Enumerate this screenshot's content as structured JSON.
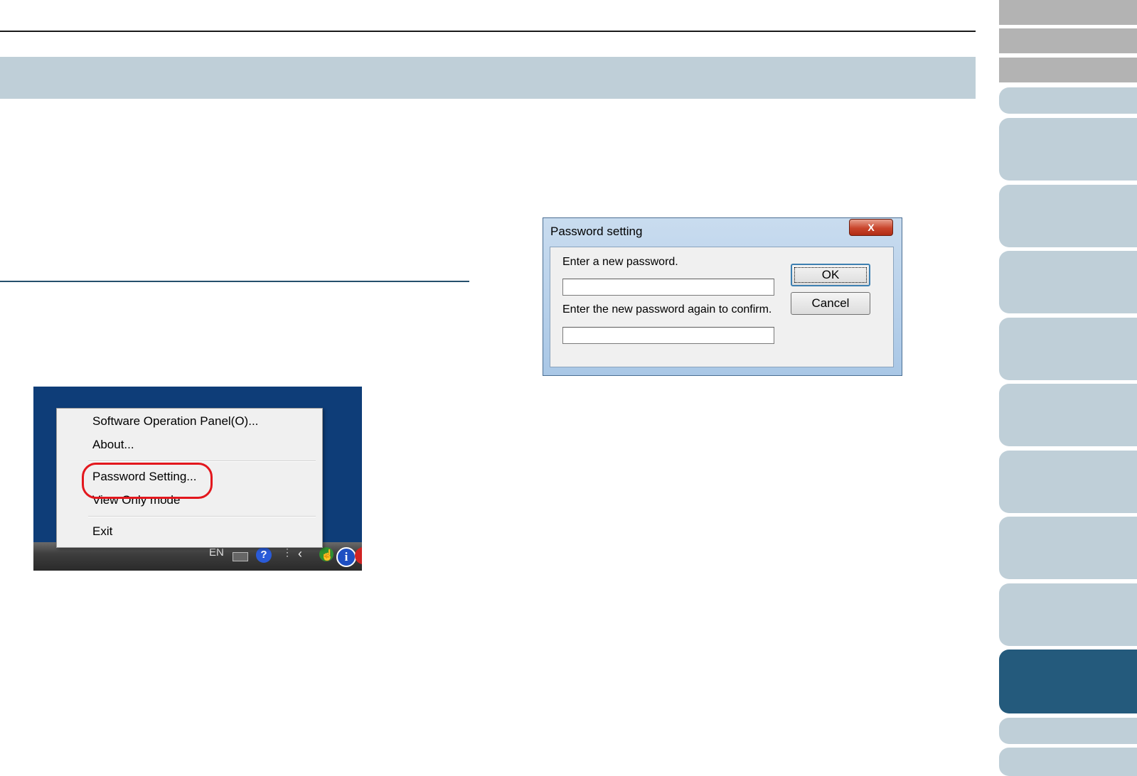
{
  "context_menu": {
    "items": [
      {
        "label": "Software Operation Panel(O)..."
      },
      {
        "label": "About..."
      },
      {
        "label": "Password Setting..."
      },
      {
        "label": "View Only mode"
      },
      {
        "label": "Exit"
      }
    ],
    "highlighted_item": "Password Setting..."
  },
  "taskbar": {
    "language": "EN",
    "help_glyph": "?",
    "info_glyph": "i",
    "icons": [
      "keyboard-icon",
      "help-icon",
      "chevron-left-icon",
      "scanner-tray-icon",
      "info-icon",
      "red-tray-icon"
    ]
  },
  "dialog": {
    "title": "Password setting",
    "close_glyph": "X",
    "label_new": "Enter a new password.",
    "label_confirm": "Enter the new password again to confirm.",
    "ok_label": "OK",
    "cancel_label": "Cancel",
    "new_password_value": "",
    "confirm_password_value": ""
  },
  "colors": {
    "title_band": "#bfcfd8",
    "section_rule": "#254f6c",
    "tab_light": "#bfcfd8",
    "tab_gray": "#b3b3b3",
    "tab_active": "#245a7c",
    "highlight_ring": "#e3171d",
    "desktop": "#0e3d78"
  }
}
